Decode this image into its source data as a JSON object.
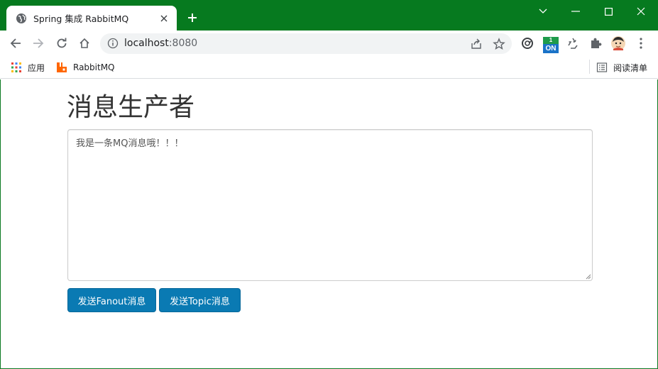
{
  "browser": {
    "tab": {
      "title": "Spring 集成 RabbitMQ"
    },
    "address": {
      "host": "localhost",
      "port": ":8080"
    },
    "bookmarks": [
      {
        "label": "应用"
      },
      {
        "label": "RabbitMQ"
      }
    ],
    "reading_list": "阅读清单",
    "extension_badge": {
      "top": "1",
      "bottom": "ON"
    }
  },
  "page": {
    "title": "消息生产者",
    "message": "我是一条MQ消息哦！！！",
    "buttons": {
      "fanout": "发送Fanout消息",
      "topic": "发送Topic消息"
    }
  },
  "colors": {
    "frame": "#067a1f",
    "button": "#0a7ab3",
    "rabbitmq_orange": "#f60"
  }
}
